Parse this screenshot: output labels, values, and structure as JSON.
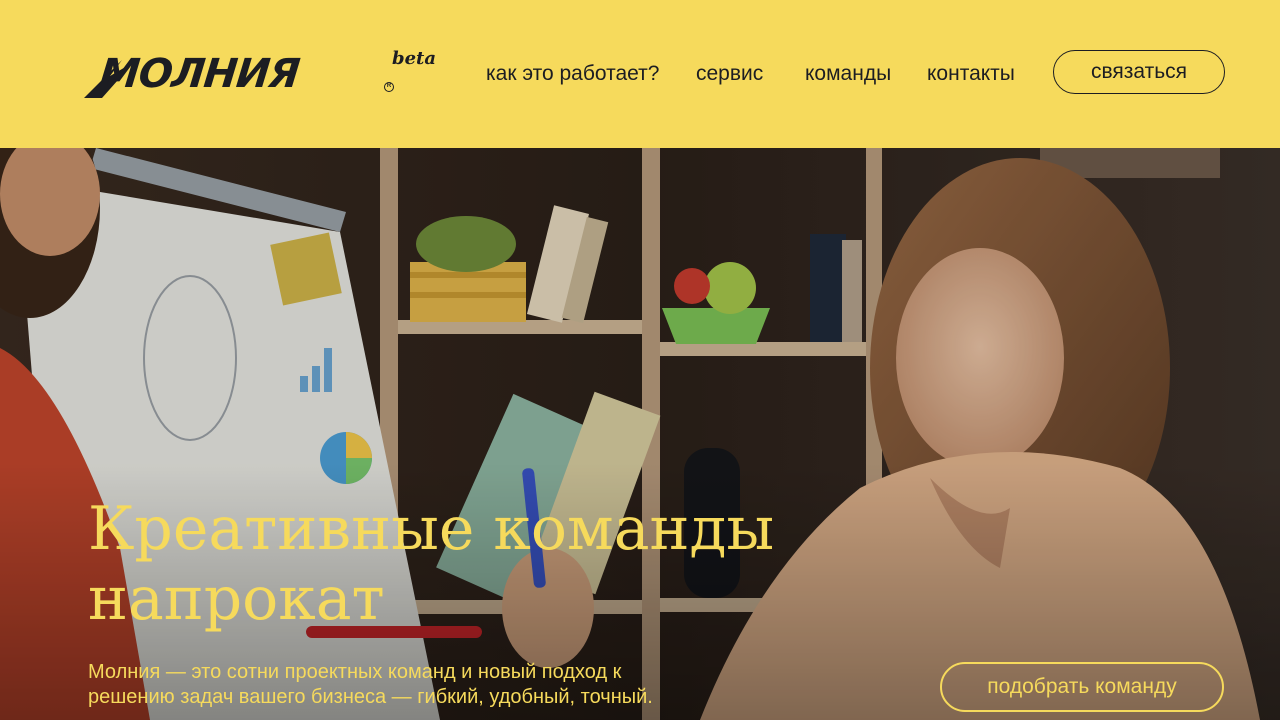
{
  "brand": {
    "name": "МОЛНИЯ",
    "badge": "beta",
    "registered_mark": "R"
  },
  "nav": {
    "items": [
      {
        "label": "как это работает?"
      },
      {
        "label": "сервис"
      },
      {
        "label": "команды"
      },
      {
        "label": "контакты"
      }
    ],
    "contact_button": "связаться"
  },
  "hero": {
    "image": "team-meeting-photo",
    "headline_line1": "Креативные команды",
    "headline_line2": "напрокат",
    "subtext_line1": "Молния — это сотни проектных команд и новый подход к",
    "subtext_line2": "решению задач вашего бизнеса — гибкий, удобный, точный.",
    "cta_button": "подобрать команду"
  },
  "colors": {
    "accent_yellow": "#f6da5c",
    "text_dark": "#1c1d22"
  }
}
